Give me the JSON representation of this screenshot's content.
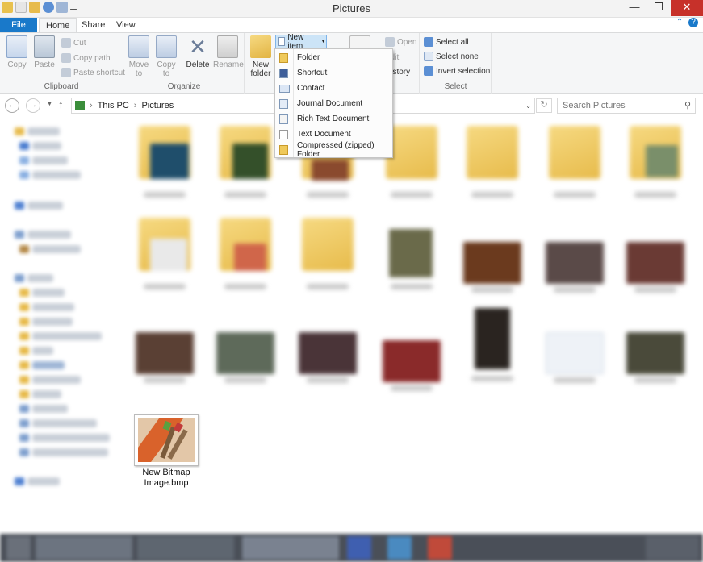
{
  "window": {
    "title": "Pictures"
  },
  "ribbon": {
    "tabs": [
      "File",
      "Home",
      "Share",
      "View"
    ],
    "clipboard": {
      "copy": "Copy",
      "paste": "Paste",
      "cut": "Cut",
      "copy_path": "Copy path",
      "paste_shortcut": "Paste shortcut",
      "label": "Clipboard"
    },
    "organize": {
      "move_to_1": "Move",
      "move_to_2": "to",
      "copy_to_1": "Copy",
      "copy_to_2": "to",
      "delete": "Delete",
      "rename": "Rename",
      "label": "Organize"
    },
    "new": {
      "new_folder_1": "New",
      "new_folder_2": "folder",
      "new_item": "New item"
    },
    "open": {
      "open": "Open",
      "edit": "Edit",
      "history": "History"
    },
    "select": {
      "select_all": "Select all",
      "select_none": "Select none",
      "invert": "Invert selection",
      "label": "Select"
    }
  },
  "new_item_menu": [
    {
      "label": "Folder",
      "icon": "folder-icon"
    },
    {
      "label": "Shortcut",
      "icon": "shortcut-icon"
    },
    {
      "label": "Contact",
      "icon": "contact-icon"
    },
    {
      "label": "Journal Document",
      "icon": "journal-icon"
    },
    {
      "label": "Rich Text Document",
      "icon": "rtf-icon"
    },
    {
      "label": "Text Document",
      "icon": "text-doc-icon"
    },
    {
      "label": "Compressed (zipped) Folder",
      "icon": "zip-folder-icon"
    }
  ],
  "address": {
    "crumbs": [
      "This PC",
      "Pictures"
    ],
    "search_placeholder": "Search Pictures"
  },
  "files": {
    "visible_item": {
      "name_line1": "New Bitmap",
      "name_line2": "Image.bmp"
    }
  },
  "colors": {
    "file_tab": "#1979ca",
    "close_button": "#c7312a",
    "selection": "#cce4f7"
  }
}
